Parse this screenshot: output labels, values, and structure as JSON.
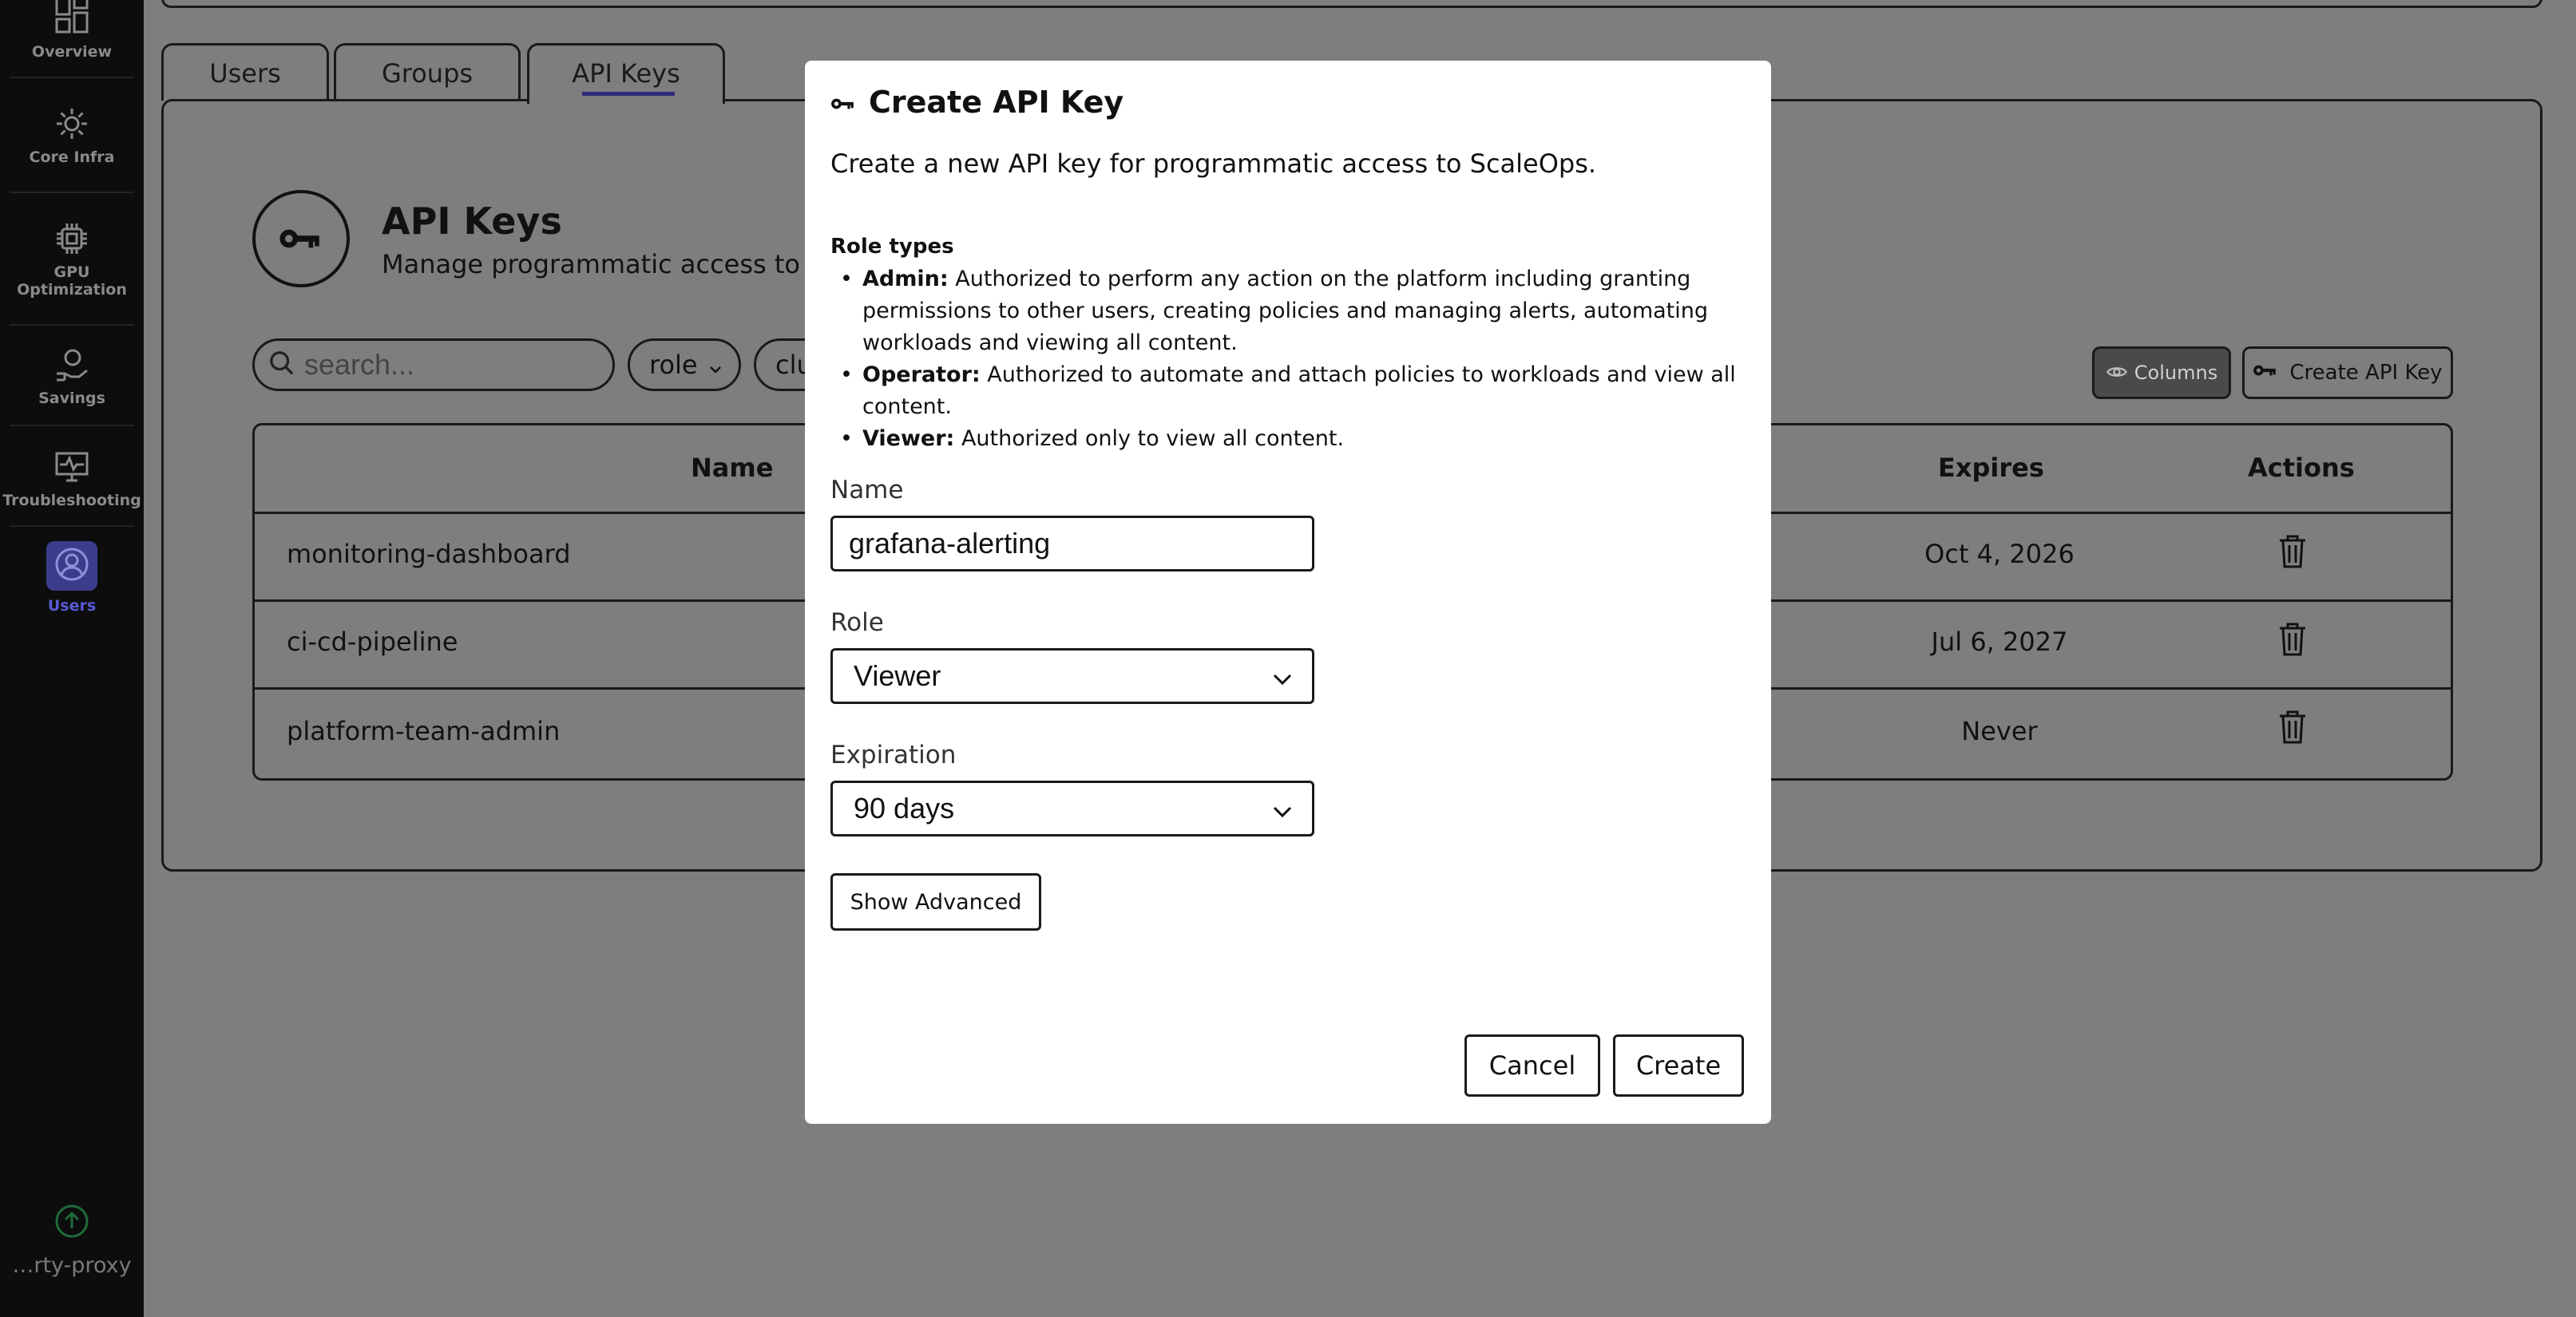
{
  "sidebar": {
    "items": [
      {
        "label": "Overview",
        "icon": "dashboard-icon"
      },
      {
        "label": "Core Infra",
        "icon": "gear-icon"
      },
      {
        "label": "GPU\nOptimization",
        "icon": "chip-icon"
      },
      {
        "label": "Savings",
        "icon": "savings-icon"
      },
      {
        "label": "Troubleshooting",
        "icon": "monitor-pulse-icon"
      },
      {
        "label": "Users",
        "icon": "user-icon"
      }
    ],
    "cluster": "…rty-proxy"
  },
  "tabs": [
    "Users",
    "Groups",
    "API Keys"
  ],
  "page": {
    "title": "API Keys",
    "subtitle": "Manage programmatic access to the"
  },
  "filters": {
    "search_placeholder": "search...",
    "role_chip": "role",
    "cluster_chip": "clu"
  },
  "toolbar": {
    "columns_label": "Columns",
    "create_label": "Create API Key"
  },
  "table": {
    "headers": {
      "name": "Name",
      "expires": "Expires",
      "actions": "Actions"
    },
    "rows": [
      {
        "name": "monitoring-dashboard",
        "expires": "Oct 4, 2026"
      },
      {
        "name": "ci-cd-pipeline",
        "expires": "Jul 6, 2027"
      },
      {
        "name": "platform-team-admin",
        "expires": "Never"
      }
    ]
  },
  "modal": {
    "title": "Create API Key",
    "description": "Create a new API key for programmatic access to ScaleOps.",
    "roles_heading": "Role types",
    "roles": [
      {
        "name": "Admin:",
        "text": "Authorized to perform any action on the platform including granting permissions to other users, creating policies and managing alerts, automating workloads and viewing all content."
      },
      {
        "name": "Operator:",
        "text": "Authorized to automate and attach policies to workloads and view all content."
      },
      {
        "name": "Viewer:",
        "text": "Authorized only to view all content."
      }
    ],
    "name_label": "Name",
    "name_value": "grafana-alerting",
    "role_label": "Role",
    "role_value": "Viewer",
    "expiration_label": "Expiration",
    "expiration_value": "90 days",
    "advanced_label": "Show Advanced",
    "cancel_label": "Cancel",
    "create_label": "Create"
  }
}
